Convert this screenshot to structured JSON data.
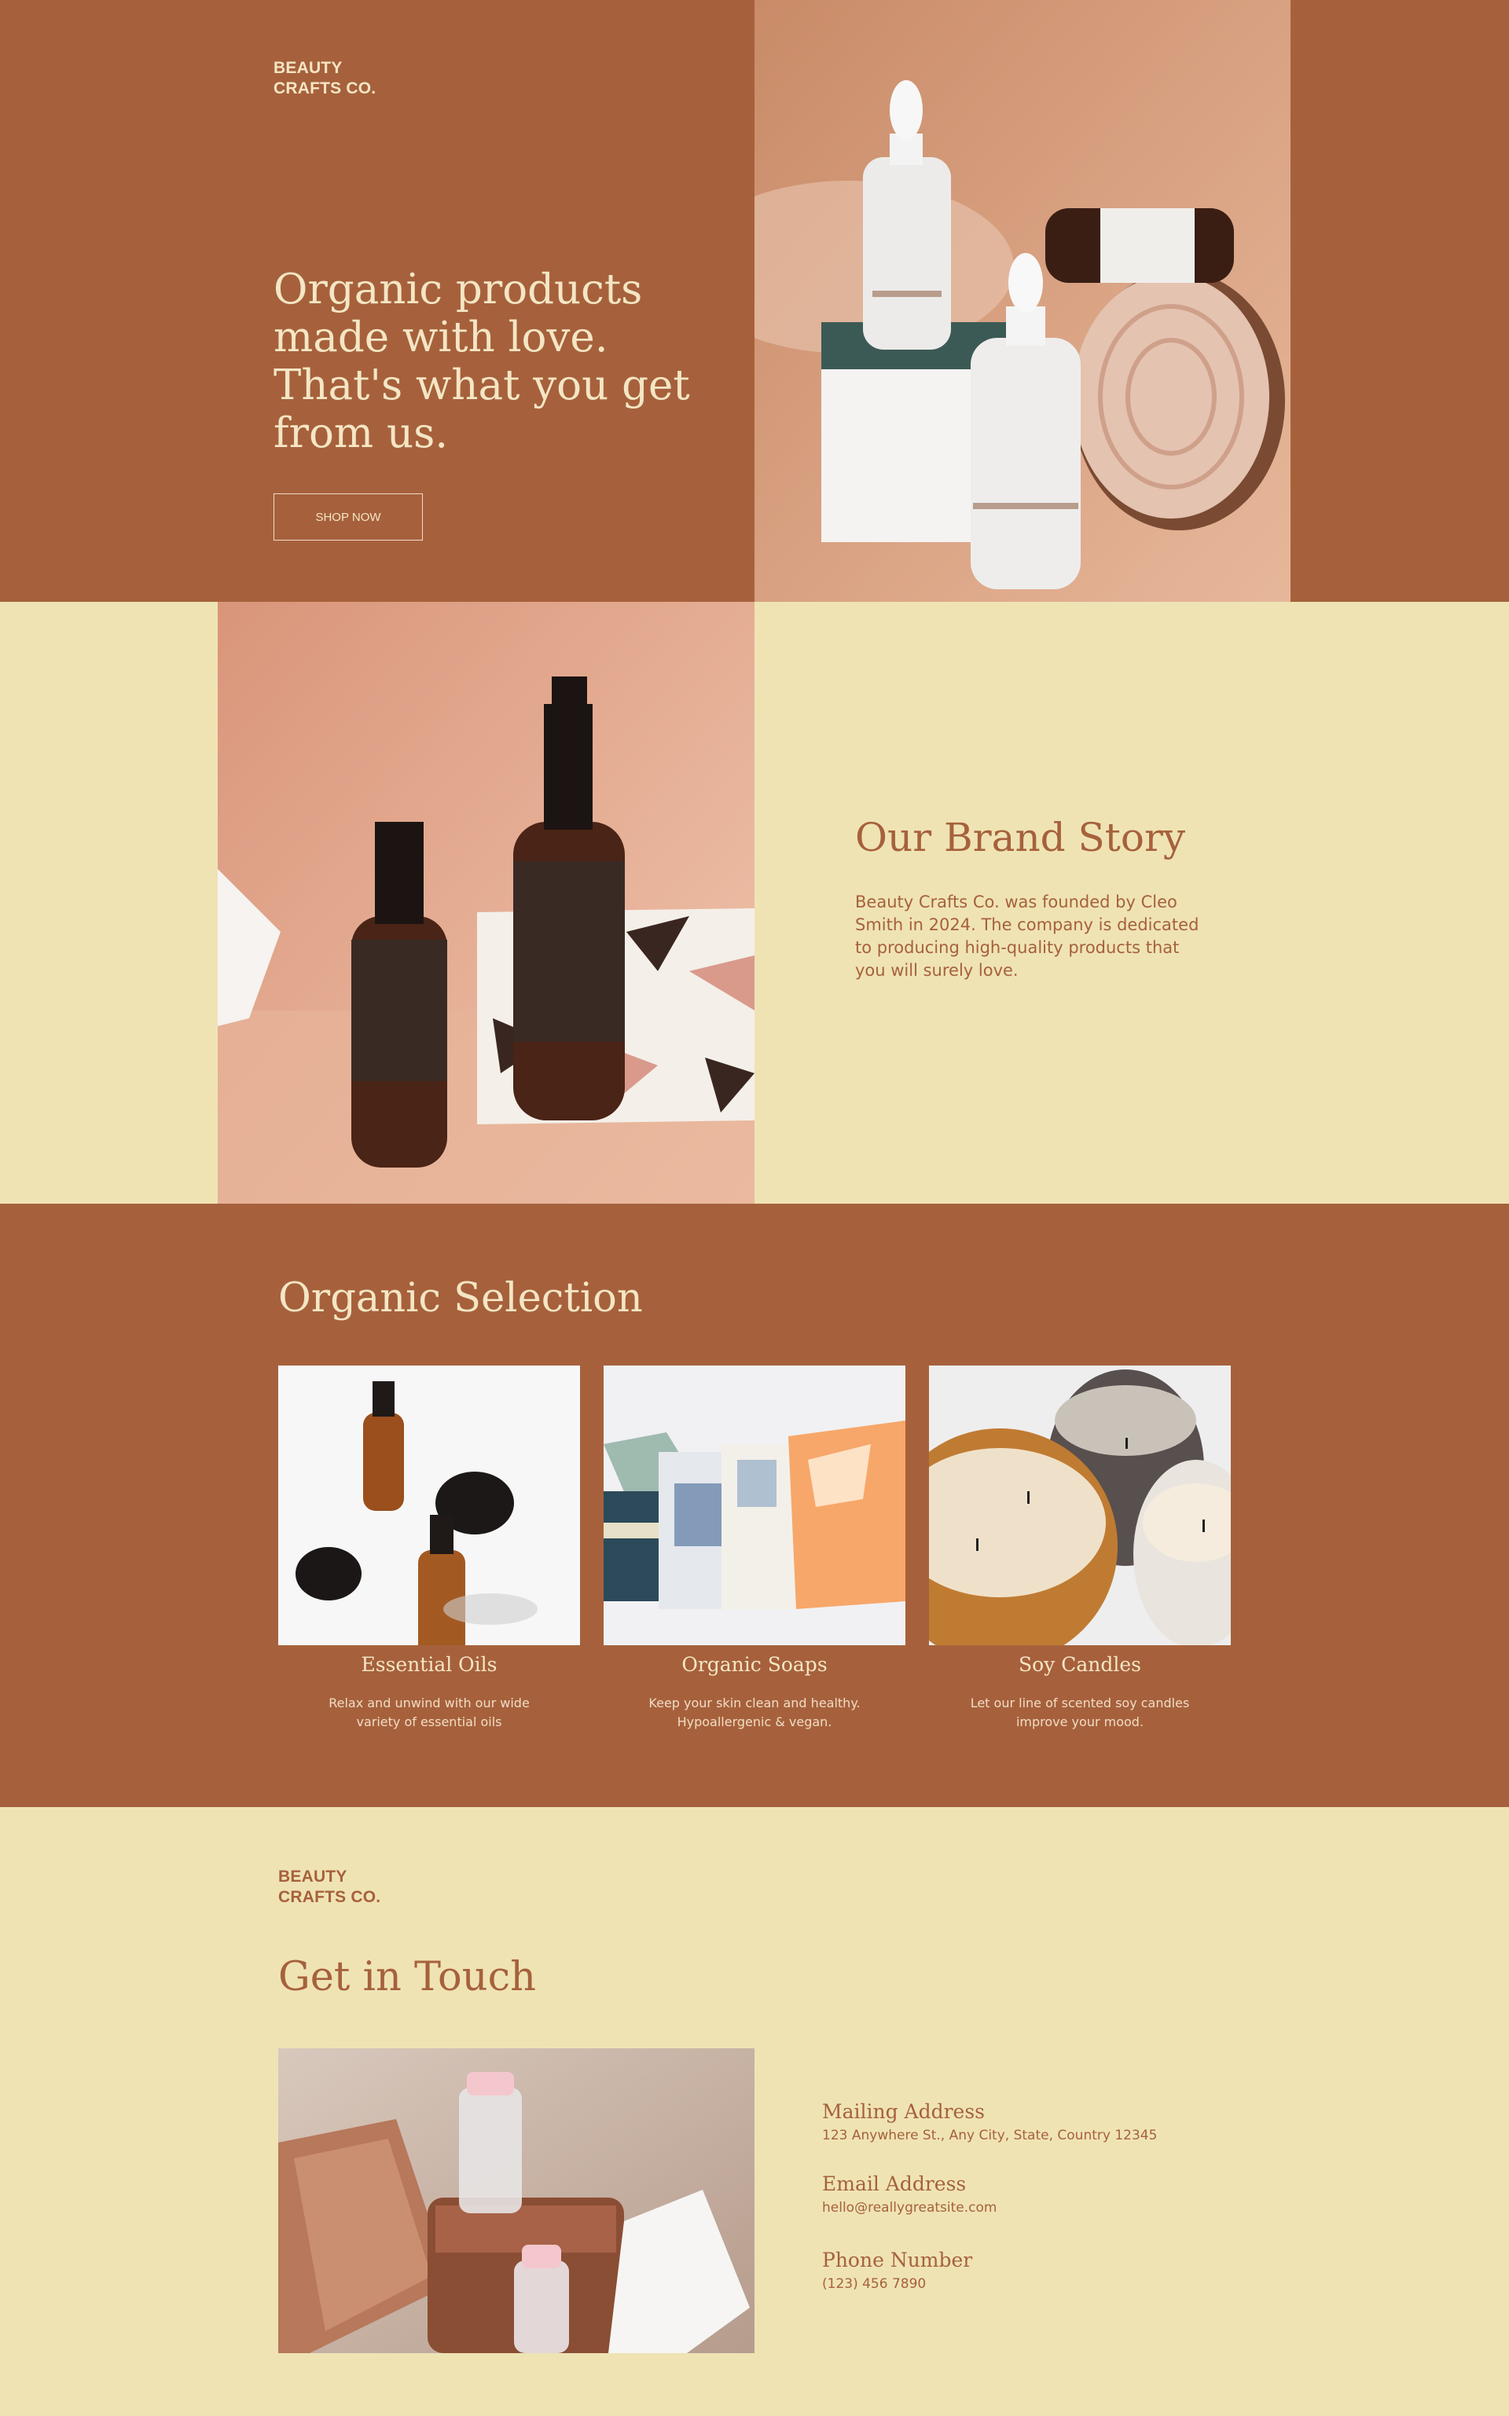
{
  "brand": {
    "name": "BEAUTY\nCRAFTS CO."
  },
  "hero": {
    "headline": "Organic products\nmade with love.\nThat's what you get\nfrom us.",
    "button_label": "SHOP NOW"
  },
  "story": {
    "title": "Our Brand Story",
    "body": "Beauty Crafts Co. was founded by Cleo Smith in 2024. The company is dedicated to producing high-quality products that you will surely love."
  },
  "selection": {
    "title": "Organic Selection",
    "items": [
      {
        "title": "Essential Oils",
        "desc": "Relax and unwind with our wide\nvariety of essential oils"
      },
      {
        "title": "Organic Soaps",
        "desc": "Keep your skin clean and healthy.\nHypoallergenic & vegan."
      },
      {
        "title": "Soy Candles",
        "desc": "Let our line of scented soy candles\nimprove your mood."
      }
    ]
  },
  "contact": {
    "title": "Get in Touch",
    "mailing_label": "Mailing Address",
    "mailing_value": "123 Anywhere St., Any City, State, Country 12345",
    "email_label": "Email Address",
    "email_value": "hello@reallygreatsite.com",
    "phone_label": "Phone Number",
    "phone_value": "(123) 456 7890"
  },
  "colors": {
    "rust": "#a6613c",
    "cream": "#efe3b4",
    "light_text": "#f4e6c4"
  }
}
